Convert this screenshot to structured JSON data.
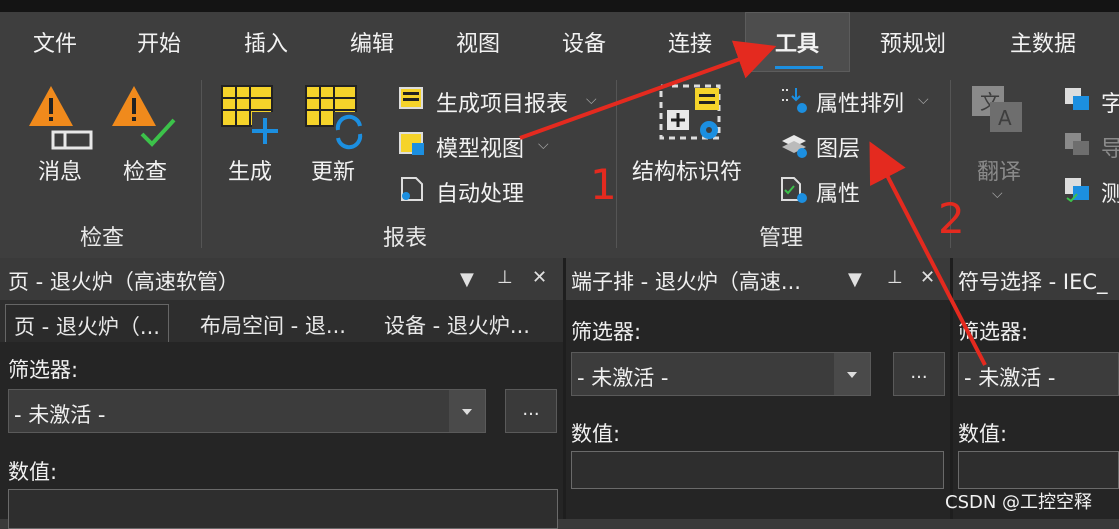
{
  "menu": {
    "items": [
      "文件",
      "开始",
      "插入",
      "编辑",
      "视图",
      "设备",
      "连接",
      "工具",
      "预规划",
      "主数据"
    ],
    "active": "工具"
  },
  "ribbon": {
    "check_group": {
      "label": "检查",
      "messages": "消息",
      "check": "检查"
    },
    "report_group": {
      "label": "报表",
      "generate": "生成",
      "update": "更新",
      "project_report": "生成项目报表",
      "model_view": "模型视图",
      "auto_process": "自动处理"
    },
    "manage_group": {
      "label": "管理",
      "structure_id": "结构标识符",
      "property_sort": "属性排列",
      "layers": "图层",
      "properties": "属性"
    },
    "translate_group": {
      "translate": "翻译",
      "item1": "字",
      "item2": "导",
      "item3": "测"
    }
  },
  "panels": {
    "page": {
      "title": "页 - 退火炉（高速软管）",
      "tabs": [
        "页 - 退火炉（...",
        "布局空间 - 退...",
        "设备 - 退火炉..."
      ],
      "filter_label": "筛选器:",
      "filter_value": "- 未激活 -",
      "value_label": "数值:",
      "more": "..."
    },
    "terminal": {
      "title": "端子排 - 退火炉（高速...",
      "filter_label": "筛选器:",
      "filter_value": "- 未激活 -",
      "value_label": "数值:",
      "more": "..."
    },
    "symbol": {
      "title": "符号选择 - IEC_",
      "filter_label": "筛选器:",
      "filter_value": "- 未激活 -",
      "value_label": "数值:"
    },
    "controls": {
      "dropdown": "▼",
      "pin": "🖈",
      "close": "✕"
    }
  },
  "annotations": {
    "one": "1",
    "two": "2"
  },
  "watermark": "CSDN @工控空释",
  "colors": {
    "accent_blue": "#1c8fe0",
    "annotation_red": "#e42a1f",
    "warning_orange": "#f08a1c",
    "check_green": "#3cc24a"
  }
}
